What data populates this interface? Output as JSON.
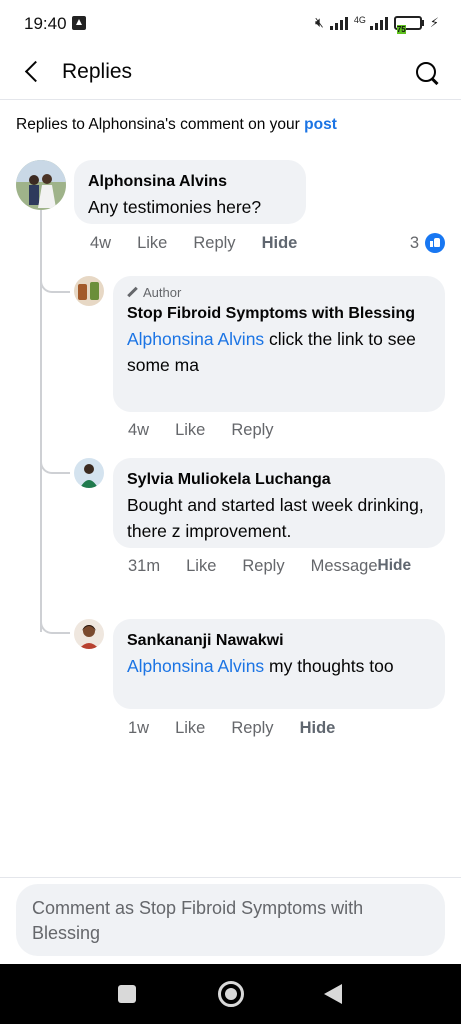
{
  "status_bar": {
    "time": "19:40",
    "network_label": "4G",
    "battery_label": "75"
  },
  "header": {
    "title": "Replies"
  },
  "context": {
    "prefix": "Replies to Alphonsina's comment on your ",
    "link": "post"
  },
  "comments": [
    {
      "author": "Alphonsina Alvins",
      "text": "Any testimonies here?",
      "time": "4w",
      "like": "Like",
      "reply": "Reply",
      "hide": "Hide",
      "reaction_count": "3"
    },
    {
      "tag": "Author",
      "author": "Stop Fibroid Symptoms with Blessing",
      "mention": "Alphonsina Alvins",
      "text": " click the link to see some ma",
      "time": "4w",
      "like": "Like",
      "reply": "Reply"
    },
    {
      "author": "Sylvia Muliokela Luchanga",
      "text": "Bought and started last week drinking, there z improvement.",
      "time": "31m",
      "like": "Like",
      "reply": "Reply",
      "message": "Message",
      "hide": "Hide"
    },
    {
      "author": "Sankananji Nawakwi",
      "mention": "Alphonsina Alvins",
      "text": " my thoughts too",
      "time": "1w",
      "like": "Like",
      "reply": "Reply",
      "hide": "Hide"
    }
  ],
  "composer": {
    "placeholder": "Comment as Stop Fibroid Symptoms with Blessing"
  },
  "colors": {
    "accent": "#1b74e4",
    "bubble": "#f0f2f5",
    "secondary_text": "#65676b"
  }
}
